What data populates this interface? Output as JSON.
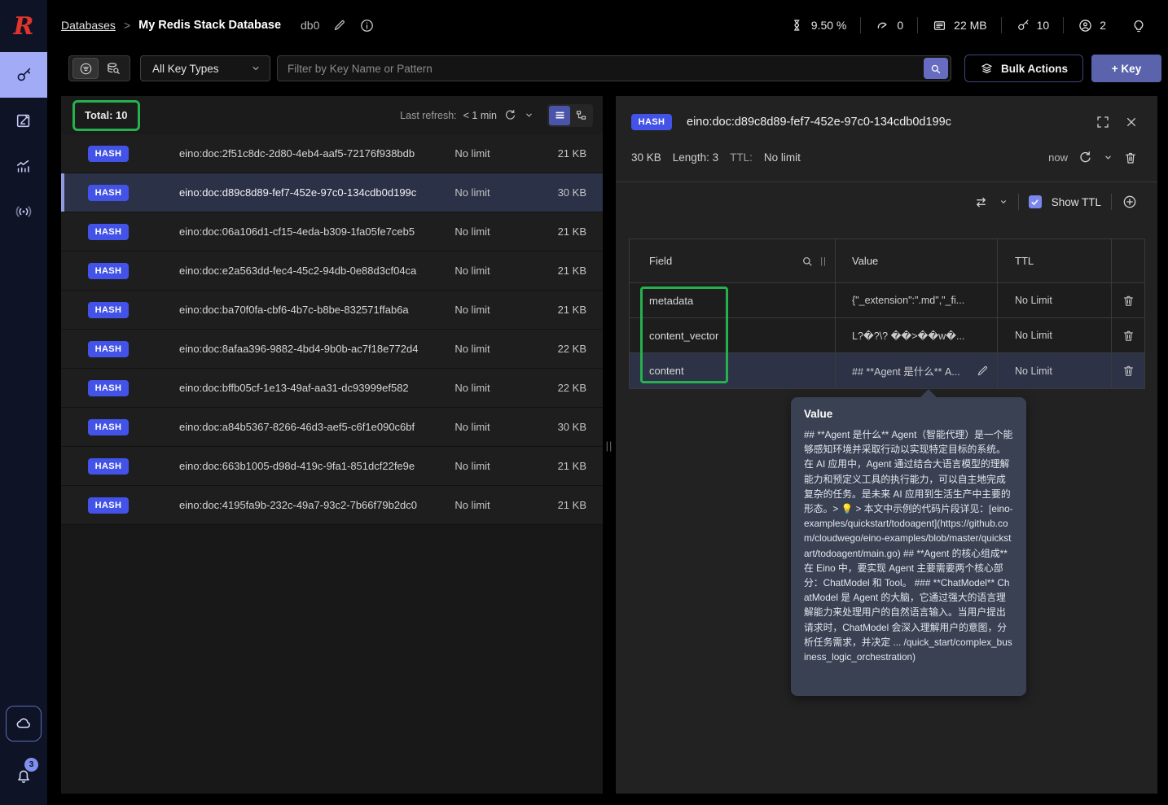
{
  "colors": {
    "annotation_green": "#25b14e",
    "hash_badge_blue": "#4353e8",
    "selected_row_bg": "#2b3147",
    "sidebar_active_bg": "#a2abf5",
    "tooltip_bg": "#3a4152",
    "primary_button_bg": "#5a63ab"
  },
  "sidebar": {
    "notification_badge": "3"
  },
  "header": {
    "breadcrumb": {
      "databases": "Databases",
      "separator": ">",
      "db_name": "My Redis Stack Database",
      "db_index": "db0"
    },
    "stats": {
      "cpu": "9.50 %",
      "ops": "0",
      "memory": "22 MB",
      "keys": "10",
      "users": "2"
    }
  },
  "filter_bar": {
    "key_type_selected": "All Key Types",
    "search_placeholder": "Filter by Key Name or Pattern",
    "bulk_actions_label": "Bulk Actions",
    "add_key_label": "+ Key"
  },
  "key_list": {
    "total_label": "Total: 10",
    "last_refresh_label": "Last refresh:",
    "last_refresh_value": "< 1 min",
    "keys": [
      {
        "type": "HASH",
        "name": "eino:doc:2f51c8dc-2d80-4eb4-aaf5-72176f938bdb",
        "ttl": "No limit",
        "size": "21 KB"
      },
      {
        "type": "HASH",
        "name": "eino:doc:d89c8d89-fef7-452e-97c0-134cdb0d199c",
        "ttl": "No limit",
        "size": "30 KB",
        "selected": true
      },
      {
        "type": "HASH",
        "name": "eino:doc:06a106d1-cf15-4eda-b309-1fa05fe7ceb5",
        "ttl": "No limit",
        "size": "21 KB"
      },
      {
        "type": "HASH",
        "name": "eino:doc:e2a563dd-fec4-45c2-94db-0e88d3cf04ca",
        "ttl": "No limit",
        "size": "21 KB"
      },
      {
        "type": "HASH",
        "name": "eino:doc:ba70f0fa-cbf6-4b7c-b8be-832571ffab6a",
        "ttl": "No limit",
        "size": "21 KB"
      },
      {
        "type": "HASH",
        "name": "eino:doc:8afaa396-9882-4bd4-9b0b-ac7f18e772d4",
        "ttl": "No limit",
        "size": "22 KB"
      },
      {
        "type": "HASH",
        "name": "eino:doc:bffb05cf-1e13-49af-aa31-dc93999ef582",
        "ttl": "No limit",
        "size": "22 KB"
      },
      {
        "type": "HASH",
        "name": "eino:doc:a84b5367-8266-46d3-aef5-c6f1e090c6bf",
        "ttl": "No limit",
        "size": "30 KB"
      },
      {
        "type": "HASH",
        "name": "eino:doc:663b1005-d98d-419c-9fa1-851dcf22fe9e",
        "ttl": "No limit",
        "size": "21 KB"
      },
      {
        "type": "HASH",
        "name": "eino:doc:4195fa9b-232c-49a7-93c2-7b66f79b2dc0",
        "ttl": "No limit",
        "size": "21 KB"
      }
    ],
    "resize_handle_glyph": "||"
  },
  "detail_panel": {
    "type_badge": "HASH",
    "key_name": "eino:doc:d89c8d89-fef7-452e-97c0-134cdb0d199c",
    "size": "30 KB",
    "length_label": "Length:",
    "length_value": "3",
    "ttl_label": "TTL:",
    "ttl_value": "No limit",
    "refresh_time": "now",
    "show_ttl_label": "Show TTL",
    "table": {
      "columns": {
        "field": "Field",
        "value": "Value",
        "ttl": "TTL"
      },
      "column_resize_glyph": "||",
      "rows": [
        {
          "field": "metadata",
          "value": "{\"_extension\":\".md\",\"_fi...",
          "ttl": "No Limit"
        },
        {
          "field": "content_vector",
          "value": "L?�?\\? ��>��w�...",
          "ttl": "No Limit"
        },
        {
          "field": "content",
          "value": "## **Agent 是什么** A...",
          "ttl": "No Limit",
          "editable": true,
          "highlighted": true
        }
      ]
    },
    "tooltip": {
      "title": "Value",
      "text": "## **Agent 是什么** Agent（智能代理）是一个能够感知环境并采取行动以实现特定目标的系统。在 AI 应用中，Agent 通过结合大语言模型的理解能力和预定义工具的执行能力，可以自主地完成复杂的任务。是未来 AI 应用到生活生产中主要的形态。> 💡 > 本文中示例的代码片段详见：[eino-examples/quickstart/todoagent](https://github.com/cloudwego/eino-examples/blob/master/quickstart/todoagent/main.go) ## **Agent 的核心组成** 在 Eino 中，要实现 Agent 主要需要两个核心部分：ChatModel 和 Tool。 ### **ChatModel** ChatModel 是 Agent 的大脑，它通过强大的语言理解能力来处理用户的自然语言输入。当用户提出请求时，ChatModel 会深入理解用户的意图，分析任务需求，并决定 ... /quick_start/complex_business_logic_orchestration)"
    }
  }
}
